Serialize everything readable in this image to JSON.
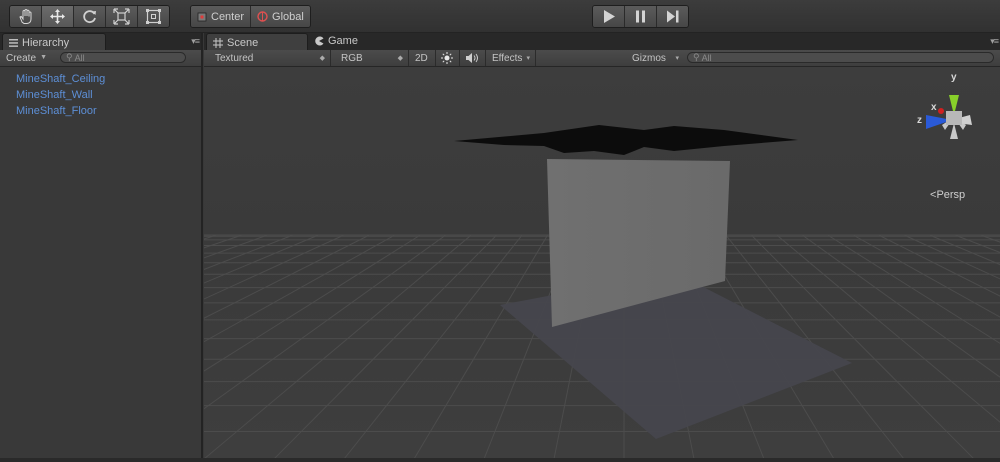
{
  "toolbar": {
    "tools": [
      {
        "name": "hand-tool-icon",
        "active": false
      },
      {
        "name": "move-tool-icon",
        "active": true
      },
      {
        "name": "rotate-tool-icon",
        "active": false
      },
      {
        "name": "scale-tool-icon",
        "active": false
      },
      {
        "name": "rect-tool-icon",
        "active": false
      }
    ],
    "pivot_label": "Center",
    "space_label": "Global",
    "play_icons": [
      "play-icon",
      "pause-icon",
      "step-icon"
    ]
  },
  "hierarchy": {
    "tab_label": "Hierarchy",
    "create_label": "Create",
    "search_placeholder": "All",
    "items": [
      "MineShaft_Ceiling",
      "MineShaft_Wall",
      "MineShaft_Floor"
    ],
    "item_color": "#5d8fd6"
  },
  "scene": {
    "tabs": [
      {
        "label": "Scene",
        "icon": "grid-icon",
        "active": true
      },
      {
        "label": "Game",
        "icon": "pacman-icon",
        "active": false
      }
    ],
    "toolbar": {
      "draw_mode": "Textured",
      "render_mode": "RGB",
      "mode_2d": "2D",
      "lighting_icon": "sun-icon",
      "audio_icon": "speaker-icon",
      "effects_label": "Effects",
      "gizmos_label": "Gizmos",
      "search_placeholder": "All"
    },
    "gizmo": {
      "x_label": "x",
      "y_label": "y",
      "z_label": "z",
      "projection_label": "Persp",
      "x_color": "#d02020",
      "y_color": "#88d02a",
      "z_color": "#2a5ad8"
    },
    "objects": [
      "ceiling-plane",
      "wall-plane",
      "floor-shadow"
    ]
  }
}
